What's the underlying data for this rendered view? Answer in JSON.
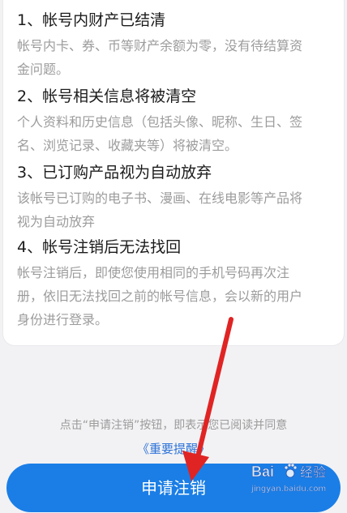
{
  "sections": [
    {
      "title": "1、帐号内财产已结清",
      "desc_lines": [
        "帐号内卡、券、币等财产余额为零，没有待结算资",
        "金问题。"
      ]
    },
    {
      "title": "2、帐号相关信息将被清空",
      "desc_lines": [
        "个人资料和历史信息（包括头像、昵称、生日、签",
        "名、浏览记录、收藏夹等）将被清空。"
      ]
    },
    {
      "title": "3、已订购产品视为自动放弃",
      "desc_lines": [
        "该帐号已订购的电子书、漫画、在线电影等产品将",
        "视为自动放弃"
      ]
    },
    {
      "title": "4、帐号注销后无法找回",
      "desc_lines": [
        "帐号注销后，即使您使用相同的手机号码再次注",
        "册，依旧无法找回之前的帐号信息，会以新的用户",
        "身份进行登录。"
      ]
    }
  ],
  "footer": {
    "notice": "点击“申请注销”按钮，即表示您已阅读并同意",
    "link": "《重要提醒》",
    "button": "申请注销"
  },
  "watermark": {
    "brand": "Bai",
    "paw_icon": "baidu-paw-icon",
    "suffix": "经验",
    "url": "jingyan.baidu.com"
  },
  "colors": {
    "accent": "#1a7ee6",
    "link": "#2f74d8",
    "arrow": "#e02424"
  }
}
